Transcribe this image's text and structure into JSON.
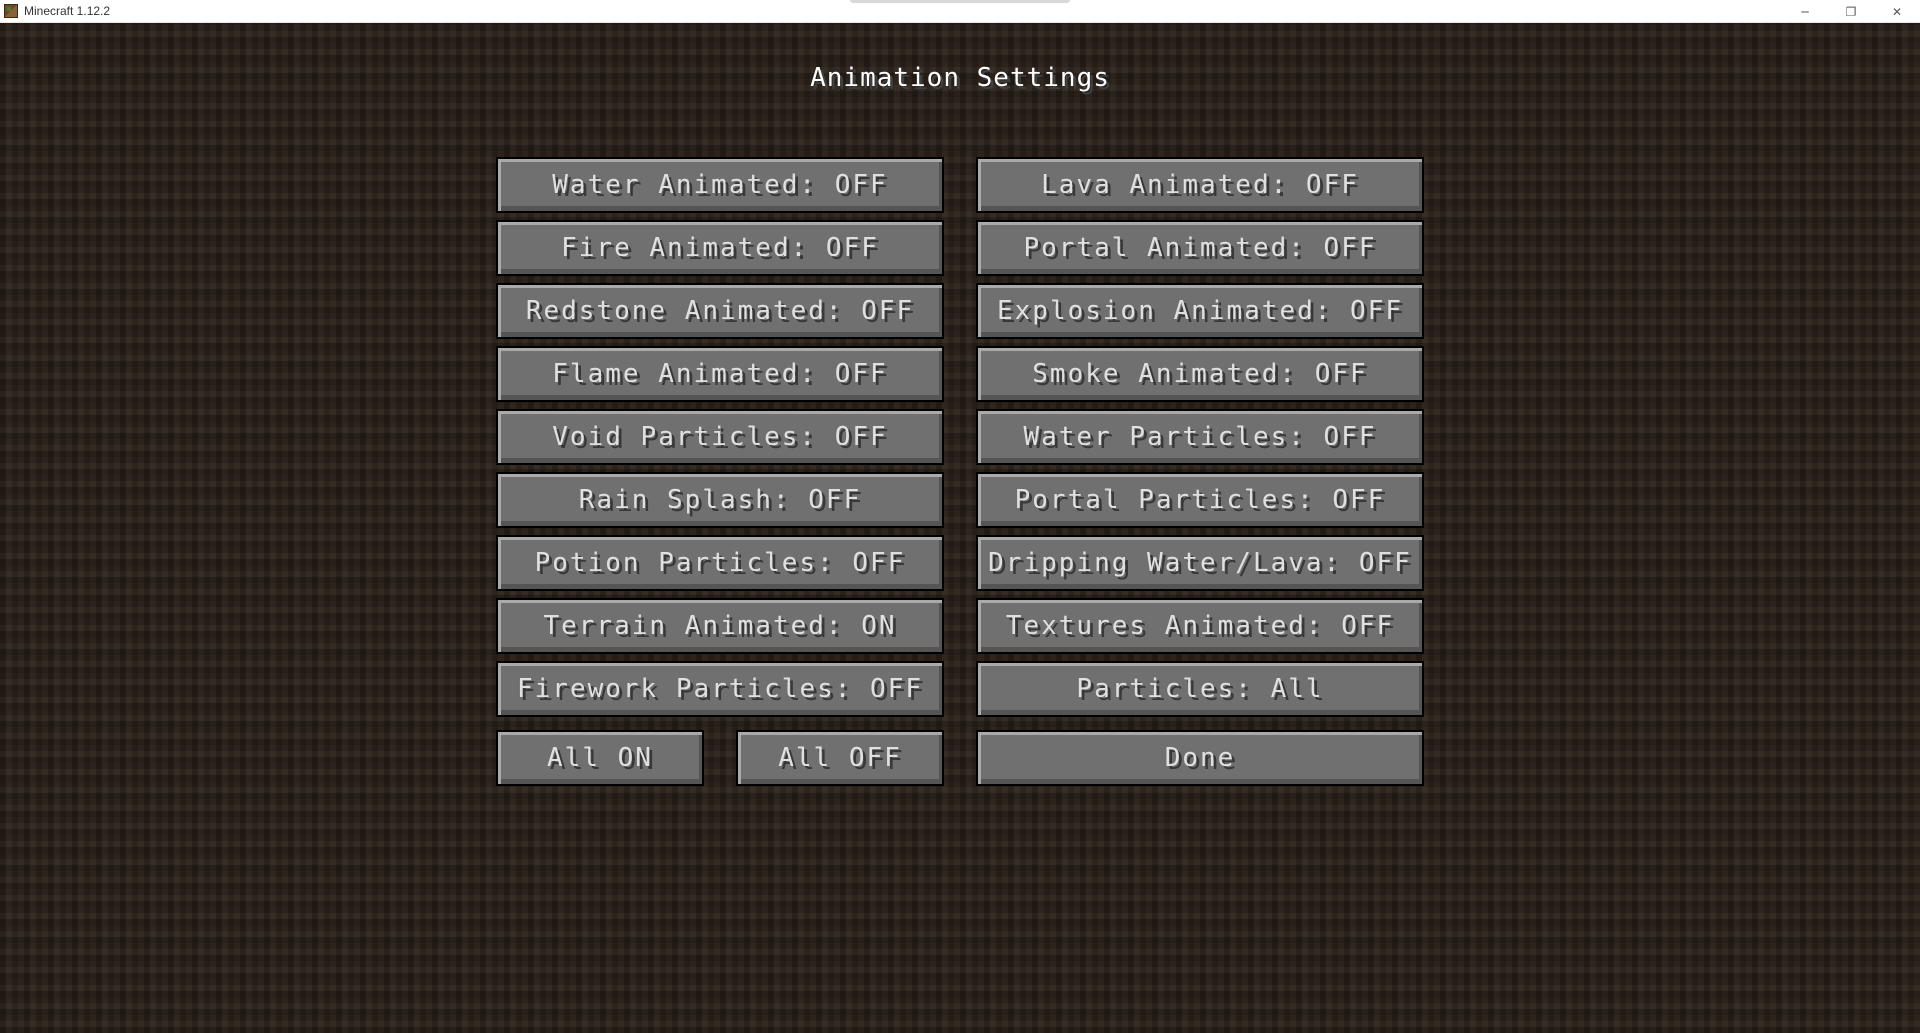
{
  "window": {
    "title": "Minecraft 1.12.2",
    "minimize": "─",
    "restore": "❐",
    "close": "✕"
  },
  "screen": {
    "title": "Animation Settings"
  },
  "options": {
    "water_animated": "Water Animated: OFF",
    "lava_animated": "Lava Animated: OFF",
    "fire_animated": "Fire Animated: OFF",
    "portal_animated": "Portal Animated: OFF",
    "redstone_animated": "Redstone Animated: OFF",
    "explosion_animated": "Explosion Animated: OFF",
    "flame_animated": "Flame Animated: OFF",
    "smoke_animated": "Smoke Animated: OFF",
    "void_particles": "Void Particles: OFF",
    "water_particles": "Water Particles: OFF",
    "rain_splash": "Rain Splash: OFF",
    "portal_particles": "Portal Particles: OFF",
    "potion_particles": "Potion Particles: OFF",
    "dripping_water_lava": "Dripping Water/Lava: OFF",
    "terrain_animated": "Terrain Animated: ON",
    "textures_animated": "Textures Animated: OFF",
    "firework_particles": "Firework Particles: OFF",
    "particles": "Particles: All"
  },
  "actions": {
    "all_on": "All ON",
    "all_off": "All OFF",
    "done": "Done"
  }
}
